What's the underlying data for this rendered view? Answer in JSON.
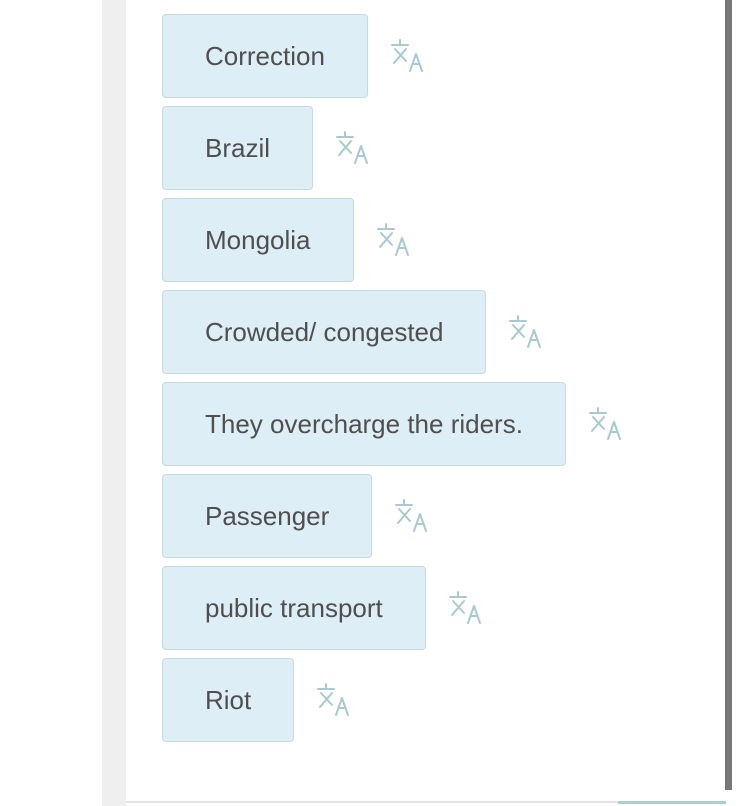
{
  "items": [
    {
      "label": "Correction",
      "icon": "translate-icon"
    },
    {
      "label": "Brazil",
      "icon": "translate-icon"
    },
    {
      "label": "Mongolia",
      "icon": "translate-icon"
    },
    {
      "label": "Crowded/ congested",
      "icon": "translate-icon"
    },
    {
      "label": "They overcharge the riders.",
      "icon": "translate-icon"
    },
    {
      "label": "Passenger",
      "icon": "translate-icon"
    },
    {
      "label": "public transport",
      "icon": "translate-icon"
    },
    {
      "label": "Riot",
      "icon": "translate-icon"
    }
  ],
  "colors": {
    "chip_background": "#deeef6",
    "chip_border": "#c4dbe6",
    "chip_text": "#4f4f4f",
    "icon_color": "#a9c9d2",
    "scrollbar": "#777777",
    "accent": "#a7d2cc"
  }
}
